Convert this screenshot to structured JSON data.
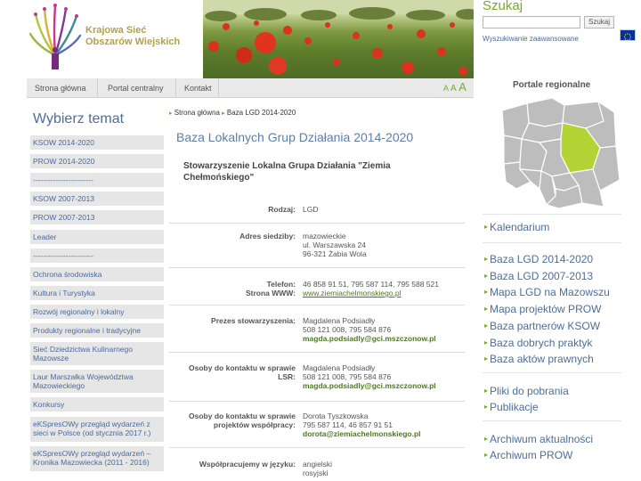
{
  "header": {
    "logo_text": [
      "Krajowa Sieć",
      "Obszarów Wiejskich"
    ],
    "search_title": "Szukaj",
    "search_button": "Szukaj",
    "advanced_search": "Wyszukiwanie zaawansowane"
  },
  "top_nav": {
    "tabs": [
      "Strona główna",
      "Portal centralny",
      "Kontakt"
    ],
    "font_sizes": [
      "A",
      "A",
      "A"
    ]
  },
  "sidebar": {
    "title": "Wybierz temat",
    "items": [
      "KSOW 2014-2020",
      "PROW 2014-2020",
      "------------------------",
      "KSOW 2007-2013",
      "PROW 2007-2013",
      "Leader",
      "------------------------",
      "Ochrona środowiska",
      "Kultura i Turystyka",
      "Rozwój regionalny i lokalny",
      "Produkty regionalne i tradycyjne",
      "Sieć Dziedzictwa Kulinarnego Mazowsze",
      "Laur Marszałka Województwa Mazowieckiego",
      "Konkursy",
      "eKSpresOWy przegląd wydarzeń z sieci w Polsce (od stycznia 2017 r.)",
      "eKSpresOWy przegląd wydarzeń – Kronika Mazowiecka (2011 - 2016)"
    ]
  },
  "main": {
    "breadcrumb": [
      "Strona główna",
      "Baza LGD 2014-2020"
    ],
    "page_title": "Baza Lokalnych Grup Działania 2014-2020",
    "org_name": "Stowarzyszenie Lokalna Grupa Działania \"Ziemia Chełmońskiego\"",
    "rows": [
      {
        "label": "Rodzaj:",
        "values": [
          "LGD"
        ]
      },
      {
        "label": "Adres siedziby:",
        "values": [
          "mazowieckie",
          "ul. Warszawska 24",
          "96-321 Żabia Wola"
        ]
      },
      {
        "label": "Telefon:",
        "values": [
          "46 858 91 51, 795 587 114, 795 588 521"
        ]
      },
      {
        "label": "Strona WWW:",
        "values": [
          "www.ziemiachelmonskiego.pl"
        ]
      },
      {
        "label": "Prezes stowarzyszenia:",
        "values": [
          "Magdalena Podsiadły",
          "508 121 008, 795 584 876",
          "magda.podsiadly@gci.mszczonow.pl"
        ]
      },
      {
        "label": "Osoby do kontaktu w sprawie LSR:",
        "values": [
          "Magdalena Podsiadły",
          "508 121 008, 795 584 876",
          "magda.podsiadly@gci.mszczonow.pl"
        ]
      },
      {
        "label": "Osoby do kontaktu w sprawie projektów współpracy:",
        "values": [
          "Dorota Tyszkowska",
          "795 587 114, 46 857 91 51",
          "dorota@ziemiachelmonskiego.pl"
        ]
      },
      {
        "label": "Współpracujemy w języku:",
        "values": [
          "angielski",
          "rosyjski"
        ]
      }
    ]
  },
  "right_col": {
    "portals_title": "Portale regionalne",
    "links": [
      "Kalendarium",
      "Baza LGD 2014-2020",
      "Baza LGD 2007-2013",
      "Mapa LGD na Mazowszu",
      "Mapa projektów PROW",
      "Baza partnerów KSOW",
      "Baza dobrych praktyk",
      "Baza aktów prawnych",
      "Pliki do pobrania",
      "Publikacje",
      "Archiwum aktualności",
      "Archiwum PROW"
    ]
  },
  "colors": {
    "accent_green": "#7aa82a",
    "link_blue": "#4d6e97",
    "map_highlight": "#b4d334",
    "map_grey": "#bdbdbd"
  }
}
